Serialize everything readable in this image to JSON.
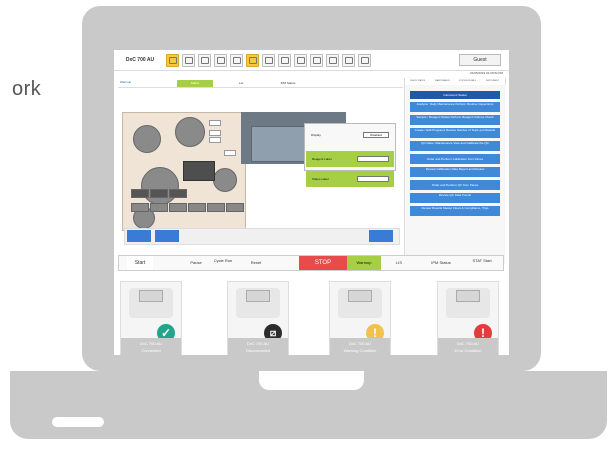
{
  "page_side_text": "ork",
  "app": {
    "title": "DxC 700 AU",
    "user": "Guest",
    "datetime": "03/25/2019 01:00:52 PM",
    "system_status": "Warmup",
    "subtabs": [
      "Status",
      "Lot",
      "IPM Status"
    ],
    "right_tabs": [
      "CHECK STATUS",
      "MAINTENANCE",
      "SYSTEM DETAILS",
      "INSTRUMENT"
    ],
    "right_head": "Instrument Status",
    "right_items": [
      "Analyzer: Daily Maintenance\nPerform Routine Inspections",
      "Sample / Reagent Status\nPerform Reagent Volume Check",
      "Create / Edit Programs\nReview Number of Tests and Results",
      "QC Data / Maintenance\nView and Calibrate the QC",
      "Order and Perform Calibration from Panes",
      "Review Calibration Data\nReport and Review",
      "Order and Perform QC from Panes",
      "Review QC Data\nTrends",
      "Review Results\nMaster Flows & Compliance, Trigs"
    ],
    "display_panel": {
      "label": "Display",
      "value": "Disabled"
    },
    "green_fields": [
      {
        "label": "Reagent Label"
      },
      {
        "label": "Status Label"
      }
    ],
    "bottom_bar": {
      "start": "Start",
      "pause": "Pause",
      "cycle_run": "Cycle\nRun",
      "reset": "Reset",
      "stop": "STOP",
      "warmup": "Warmup",
      "lot": "LIS",
      "ipm": "IPM Status",
      "stat": "STAT\nStart"
    }
  },
  "devices": [
    {
      "line1": "DxC 700 AU",
      "line2": "Connected",
      "icon": "check-circle-icon"
    },
    {
      "line1": "DxC 700 AU",
      "line2": "Disconnected",
      "icon": "disconnected-icon"
    },
    {
      "line1": "DxC 700 AU",
      "line2": "Warning Condition",
      "icon": "warning-icon"
    },
    {
      "line1": "DxC 700 AU",
      "line2": "Error Condition",
      "icon": "error-icon"
    }
  ],
  "colors": {
    "stop": "#e84b4b",
    "green": "#a7cf46",
    "blue": "#3f89d9",
    "warning": "#f2c24a",
    "error": "#e53b3b",
    "success": "#22a58c"
  }
}
